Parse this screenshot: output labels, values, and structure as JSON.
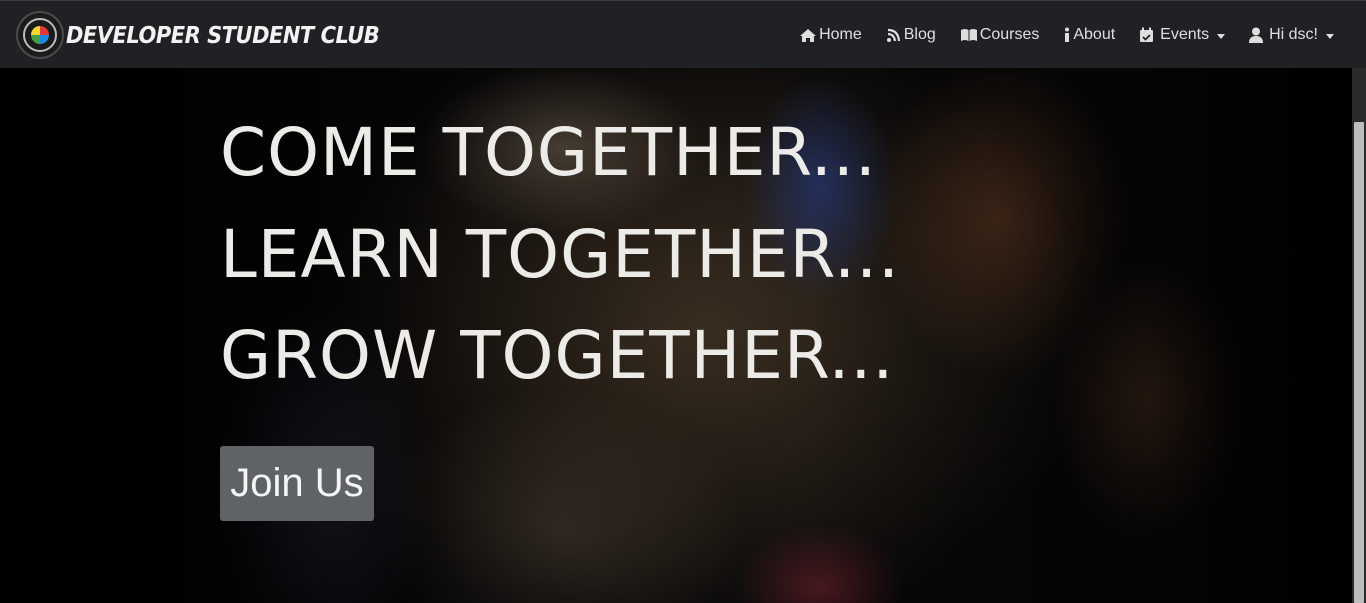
{
  "navbar": {
    "brand_text": "DEVELOPER STUDENT CLUB",
    "items": [
      {
        "label": "Home",
        "icon": "home-icon"
      },
      {
        "label": "Blog",
        "icon": "blog-icon"
      },
      {
        "label": "Courses",
        "icon": "book-icon"
      },
      {
        "label": "About",
        "icon": "info-icon"
      },
      {
        "label": "Events",
        "icon": "calendar-check-icon",
        "dropdown": true
      },
      {
        "label": "Hi dsc!",
        "icon": "user-icon",
        "dropdown": true
      }
    ]
  },
  "hero": {
    "lines": [
      "COME TOGETHER...",
      "LEARN TOGETHER...",
      "GROW TOGETHER..."
    ],
    "cta_label": "Join Us"
  },
  "colors": {
    "navbar_bg": "#1f2124",
    "headline": "#ecebe8",
    "button_bg": "#5f6366"
  }
}
